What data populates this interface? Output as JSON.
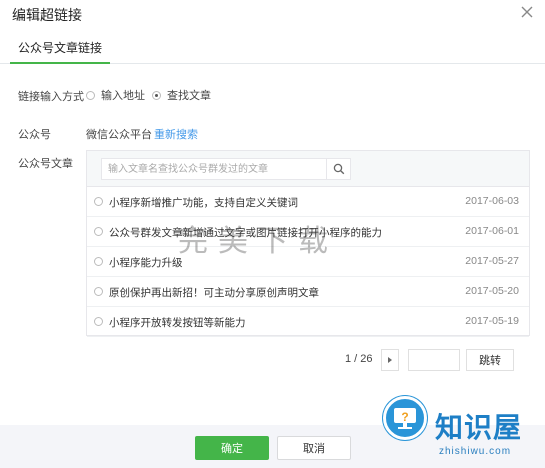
{
  "dialog": {
    "title": "编辑超链接"
  },
  "tabs": [
    {
      "label": "公众号文章链接",
      "active": true
    }
  ],
  "link_mode": {
    "label": "链接输入方式",
    "options": [
      {
        "label": "输入地址",
        "selected": false
      },
      {
        "label": "查找文章",
        "selected": true
      }
    ]
  },
  "account": {
    "label": "公众号",
    "name": "微信公众平台",
    "research_link": "重新搜索"
  },
  "articles": {
    "label": "公众号文章",
    "search_placeholder": "输入文章名查找公众号群发过的文章",
    "items": [
      {
        "title": "小程序新增推广功能，支持自定义关键词",
        "date": "2017-06-03"
      },
      {
        "title": "公众号群发文章新增通过文字或图片链接打开小程序的能力",
        "date": "2017-06-01"
      },
      {
        "title": "小程序能力升级",
        "date": "2017-05-27"
      },
      {
        "title": "原创保护再出新招！可主动分享原创声明文章",
        "date": "2017-05-20"
      },
      {
        "title": "小程序开放转发按钮等新能力",
        "date": "2017-05-19"
      }
    ]
  },
  "pagination": {
    "current": "1 / 26",
    "jump_label": "跳转",
    "page_input": ""
  },
  "footer": {
    "ok_label": "确定",
    "cancel_label": "取消"
  },
  "watermark": "完美下载",
  "logo": {
    "text": "知识屋",
    "url": "zhishiwu.com"
  },
  "colors": {
    "accent": "#44b549",
    "link": "#459ae9",
    "logo_blue": "#1e7fc6"
  }
}
